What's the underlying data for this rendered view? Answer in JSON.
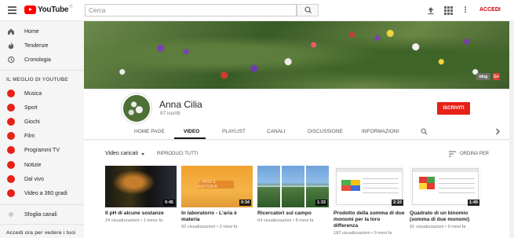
{
  "topbar": {
    "logo_text": "YouTube",
    "logo_country": "IT",
    "search_placeholder": "Cerca",
    "signin_label": "ACCEDI"
  },
  "sidebar": {
    "main_items": [
      {
        "label": "Home",
        "icon": "home-icon"
      },
      {
        "label": "Tendenze",
        "icon": "flame-icon"
      },
      {
        "label": "Cronologia",
        "icon": "history-icon"
      }
    ],
    "best_heading": "IL MEGLIO DI YOUTUBE",
    "best_items": [
      {
        "label": "Musica",
        "icon": "music-icon"
      },
      {
        "label": "Sport",
        "icon": "sport-icon"
      },
      {
        "label": "Giochi",
        "icon": "games-icon"
      },
      {
        "label": "Film",
        "icon": "film-icon"
      },
      {
        "label": "Programmi TV",
        "icon": "tv-icon"
      },
      {
        "label": "Notizie",
        "icon": "news-icon"
      },
      {
        "label": "Dal vivo",
        "icon": "live-icon"
      },
      {
        "label": "Video a 360 gradi",
        "icon": "360-icon"
      }
    ],
    "browse_channels": "Sfoglia canali",
    "signin_prompt": "Accedi ora per vedere i tuoi"
  },
  "channel": {
    "name": "Anna Cilia",
    "subscribers": "97 iscritti",
    "subscribe_label": "ISCRIVITI",
    "banner_links": [
      "blog",
      "G+"
    ]
  },
  "tabs": [
    "HOME PAGE",
    "VIDEO",
    "PLAYLIST",
    "CANALI",
    "DISCUSSIONE",
    "INFORMAZIONI"
  ],
  "active_tab": "VIDEO",
  "toolbar": {
    "sort_select": "Video caricati",
    "play_all": "RIPRODUCI TUTTI",
    "sort_by": "ORDINA PER"
  },
  "videos": [
    {
      "title": "Il pH di alcune sostanze",
      "views": "24 visualizzazioni",
      "age": "1 mese fa",
      "duration": "0:45"
    },
    {
      "title": "In laboratorio - L'aria è materia",
      "views": "92 visualizzazioni",
      "age": "2 mesi fa",
      "duration": "0:34",
      "thumb_text": "L'ARIA È MATERIA"
    },
    {
      "title": "Ricercatori sul campo",
      "views": "64 visualizzazioni",
      "age": "8 mesi fa",
      "duration": "1:33"
    },
    {
      "title": "Prodotto della somma di due monomi per la loro differenza",
      "views": "182 visualizzazioni",
      "age": "9 mesi fa",
      "duration": "2:10"
    },
    {
      "title": "Quadrato di un binomio (somma di due monomi)",
      "views": "91 visualizzazioni",
      "age": "9 mesi fa",
      "duration": "1:49"
    }
  ],
  "meta_separator": " • "
}
